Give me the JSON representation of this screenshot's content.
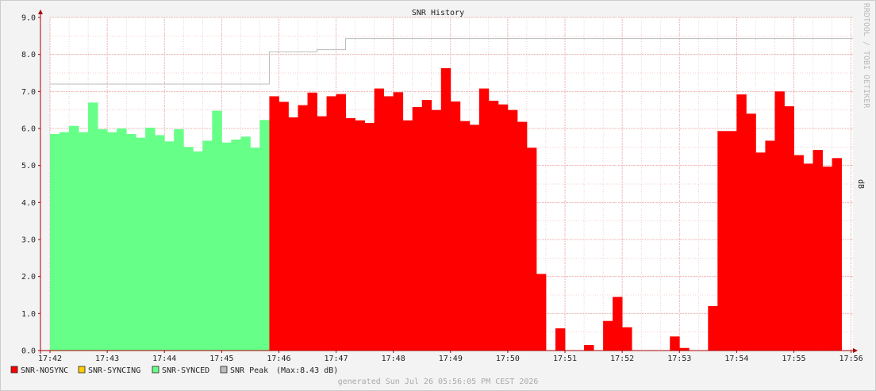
{
  "chart_data": {
    "type": "area",
    "title": "SNR History",
    "ylabel": "dB",
    "watermark": "RRDTOOL / TOBI OETIKER",
    "footer": "generated Sun Jul 26 05:56:05 PM CEST 2026",
    "x_ticks": [
      "17:42",
      "17:43",
      "17:44",
      "17:45",
      "17:46",
      "17:47",
      "17:48",
      "17:49",
      "17:50",
      "17:51",
      "17:52",
      "17:53",
      "17:54",
      "17:55",
      "17:56"
    ],
    "y_ticks": [
      "0.0",
      "1.0",
      "2.0",
      "3.0",
      "4.0",
      "5.0",
      "6.0",
      "7.0",
      "8.0",
      "9.0"
    ],
    "ylim": [
      0,
      9
    ],
    "grid": true,
    "legend": [
      {
        "name": "SNR-NOSYNC",
        "color": "#ff0000"
      },
      {
        "name": "SNR-SYNCING",
        "color": "#ffcc00"
      },
      {
        "name": "SNR-SYNCED",
        "color": "#66ff88"
      },
      {
        "name": "SNR Peak",
        "color": "#bbbbbb",
        "note": "(Max:8.43 dB)"
      }
    ],
    "colors": {
      "nosync": "#ff0000",
      "synced": "#66ff88",
      "peak": "#bbbbbb",
      "grid": "#e8a0a0",
      "axis": "#aa0000"
    },
    "synced": [
      5.85,
      5.9,
      6.07,
      5.9,
      6.7,
      5.98,
      5.9,
      6.0,
      5.85,
      5.75,
      6.02,
      5.82,
      5.65,
      5.98,
      5.5,
      5.38,
      5.67,
      6.48,
      5.62,
      5.7,
      5.78,
      5.48,
      6.23
    ],
    "nosync": [
      6.87,
      6.72,
      6.3,
      6.63,
      6.97,
      6.33,
      6.87,
      6.93,
      6.28,
      6.22,
      6.15,
      7.08,
      6.87,
      6.98,
      6.22,
      6.58,
      6.77,
      6.5,
      7.63,
      6.73,
      6.2,
      6.1,
      7.08,
      6.75,
      6.65,
      6.5,
      6.18,
      5.48,
      2.07,
      0,
      0.6,
      0,
      0,
      0.15,
      0,
      0.8,
      1.45,
      0.63,
      0,
      0,
      0,
      0,
      0.38,
      0.07,
      0,
      0,
      1.2,
      5.93,
      5.93,
      6.92,
      6.4,
      5.35,
      5.67,
      7.0,
      6.6,
      5.28,
      5.05,
      5.42,
      4.97,
      5.2
    ],
    "peak": [
      {
        "x": 0,
        "y": 7.2
      },
      {
        "x": 23,
        "y": 8.07
      },
      {
        "x": 28,
        "y": 8.13
      },
      {
        "x": 31,
        "y": 8.43
      },
      {
        "x": 84.2,
        "y": 8.43
      }
    ],
    "x_total": 84.2
  }
}
